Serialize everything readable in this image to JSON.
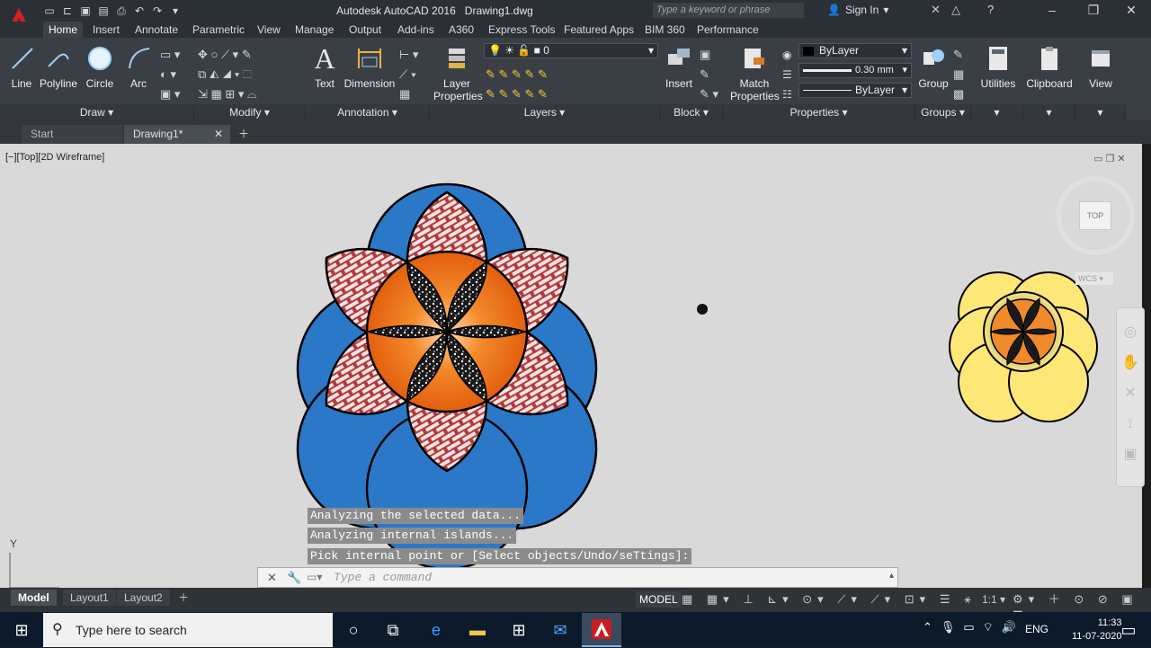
{
  "app": {
    "title": "Autodesk AutoCAD 2016",
    "document": "Drawing1.dwg",
    "search_placeholder": "Type a keyword or phrase",
    "sign_in": "Sign In"
  },
  "ribbon_tabs": [
    "Home",
    "Insert",
    "Annotate",
    "Parametric",
    "View",
    "Manage",
    "Output",
    "Add-ins",
    "A360",
    "Express Tools",
    "Featured Apps",
    "BIM 360",
    "Performance"
  ],
  "draw": {
    "line": "Line",
    "polyline": "Polyline",
    "circle": "Circle",
    "arc": "Arc",
    "panel": "Draw"
  },
  "modify": {
    "panel": "Modify"
  },
  "annotation": {
    "text": "Text",
    "dimension": "Dimension",
    "panel": "Annotation"
  },
  "layers": {
    "layer_properties": "Layer Properties",
    "current_layer": "0",
    "panel": "Layers"
  },
  "block": {
    "insert": "Insert",
    "panel": "Block"
  },
  "properties": {
    "match": "Match Properties",
    "color": "ByLayer",
    "lineweight": "0.30 mm",
    "linetype": "ByLayer",
    "panel": "Properties"
  },
  "groups": {
    "group": "Group",
    "panel": "Groups"
  },
  "utilities": "Utilities",
  "clipboard": "Clipboard",
  "view": "View",
  "file_tabs": {
    "start": "Start",
    "drawing": "Drawing1*"
  },
  "viewport_label": "[−][Top][2D Wireframe]",
  "viewcube": {
    "face": "TOP",
    "wcs": "WCS"
  },
  "command": {
    "lines": [
      "Analyzing the selected data...",
      "Analyzing internal islands...",
      "Pick internal point or [Select objects/Undo/seTtings]:"
    ],
    "placeholder": "Type a command"
  },
  "layout_tabs": [
    "Model",
    "Layout1",
    "Layout2"
  ],
  "status": {
    "model": "MODEL",
    "scale": "1:1"
  },
  "taskbar": {
    "search": "Type here to search",
    "lang": "ENG",
    "time": "11:33",
    "date": "11-07-2020"
  },
  "ucs_axis": "Y"
}
